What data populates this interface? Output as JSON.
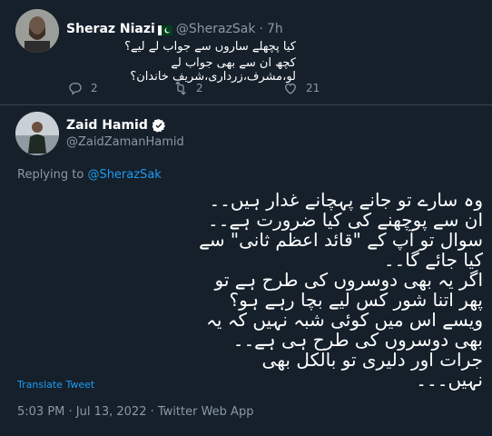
{
  "tweet1": {
    "name": "Sheraz Niazi",
    "handle": "@SherazSak",
    "separator": "·",
    "time": "7h",
    "lines": [
      "کیا پچھلے ساروں سے جواب لے لیے؟",
      "کچھ ان سے بھی جواب لے لو،مشرف،زرداری،شریف خاندان؟"
    ],
    "replies": "2",
    "retweets": "2",
    "likes": "21",
    "icons": [
      "flag-pakistan-icon",
      "reply-icon",
      "retweet-icon",
      "like-icon"
    ]
  },
  "tweet2": {
    "name": "Zaid Hamid",
    "handle": "@ZaidZamanHamid",
    "replying_prefix": "Replying to ",
    "replying_to": "@SherazSak",
    "lines": [
      "وہ سارے تو جانے پہچانے غدار ہیں۔۔",
      "ان سے پوچھنے کی کیا ضرورت ہے۔۔",
      "سوال تو آپ کے \"قائد اعظم ثانی\" سے کیا جائے گا۔۔",
      "اگر یہ بھی دوسروں کی طرح ہے تو پھر اتنا شور کس لیے بچا رہے ہو؟",
      "ویسے اس میں کوئی شبہ نہیں کہ یہ بھی دوسروں کی طرح ہی ہے۔۔",
      "جرات اور دلیری تو بالکل بھی نہیں۔۔۔"
    ],
    "translate_label": "Translate Tweet",
    "meta": "5:03 PM · Jul 13, 2022 · Twitter Web App",
    "icons": [
      "verified-badge-icon"
    ]
  },
  "colors": {
    "background": "#15202b",
    "text": "#ffffff",
    "muted": "#8b98a5",
    "link": "#1d9bf0",
    "border": "#38444d"
  }
}
